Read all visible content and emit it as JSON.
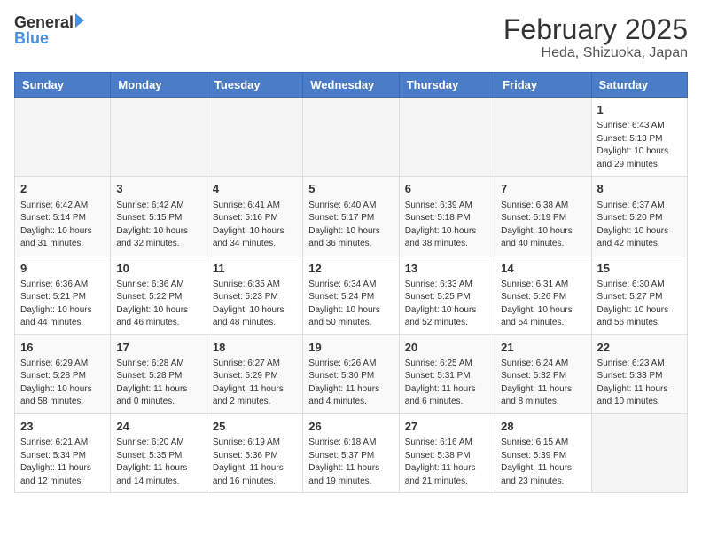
{
  "header": {
    "logo_general": "General",
    "logo_blue": "Blue",
    "month": "February 2025",
    "location": "Heda, Shizuoka, Japan"
  },
  "weekdays": [
    "Sunday",
    "Monday",
    "Tuesday",
    "Wednesday",
    "Thursday",
    "Friday",
    "Saturday"
  ],
  "weeks": [
    [
      {
        "day": "",
        "info": ""
      },
      {
        "day": "",
        "info": ""
      },
      {
        "day": "",
        "info": ""
      },
      {
        "day": "",
        "info": ""
      },
      {
        "day": "",
        "info": ""
      },
      {
        "day": "",
        "info": ""
      },
      {
        "day": "1",
        "info": "Sunrise: 6:43 AM\nSunset: 5:13 PM\nDaylight: 10 hours and 29 minutes."
      }
    ],
    [
      {
        "day": "2",
        "info": "Sunrise: 6:42 AM\nSunset: 5:14 PM\nDaylight: 10 hours and 31 minutes."
      },
      {
        "day": "3",
        "info": "Sunrise: 6:42 AM\nSunset: 5:15 PM\nDaylight: 10 hours and 32 minutes."
      },
      {
        "day": "4",
        "info": "Sunrise: 6:41 AM\nSunset: 5:16 PM\nDaylight: 10 hours and 34 minutes."
      },
      {
        "day": "5",
        "info": "Sunrise: 6:40 AM\nSunset: 5:17 PM\nDaylight: 10 hours and 36 minutes."
      },
      {
        "day": "6",
        "info": "Sunrise: 6:39 AM\nSunset: 5:18 PM\nDaylight: 10 hours and 38 minutes."
      },
      {
        "day": "7",
        "info": "Sunrise: 6:38 AM\nSunset: 5:19 PM\nDaylight: 10 hours and 40 minutes."
      },
      {
        "day": "8",
        "info": "Sunrise: 6:37 AM\nSunset: 5:20 PM\nDaylight: 10 hours and 42 minutes."
      }
    ],
    [
      {
        "day": "9",
        "info": "Sunrise: 6:36 AM\nSunset: 5:21 PM\nDaylight: 10 hours and 44 minutes."
      },
      {
        "day": "10",
        "info": "Sunrise: 6:36 AM\nSunset: 5:22 PM\nDaylight: 10 hours and 46 minutes."
      },
      {
        "day": "11",
        "info": "Sunrise: 6:35 AM\nSunset: 5:23 PM\nDaylight: 10 hours and 48 minutes."
      },
      {
        "day": "12",
        "info": "Sunrise: 6:34 AM\nSunset: 5:24 PM\nDaylight: 10 hours and 50 minutes."
      },
      {
        "day": "13",
        "info": "Sunrise: 6:33 AM\nSunset: 5:25 PM\nDaylight: 10 hours and 52 minutes."
      },
      {
        "day": "14",
        "info": "Sunrise: 6:31 AM\nSunset: 5:26 PM\nDaylight: 10 hours and 54 minutes."
      },
      {
        "day": "15",
        "info": "Sunrise: 6:30 AM\nSunset: 5:27 PM\nDaylight: 10 hours and 56 minutes."
      }
    ],
    [
      {
        "day": "16",
        "info": "Sunrise: 6:29 AM\nSunset: 5:28 PM\nDaylight: 10 hours and 58 minutes."
      },
      {
        "day": "17",
        "info": "Sunrise: 6:28 AM\nSunset: 5:28 PM\nDaylight: 11 hours and 0 minutes."
      },
      {
        "day": "18",
        "info": "Sunrise: 6:27 AM\nSunset: 5:29 PM\nDaylight: 11 hours and 2 minutes."
      },
      {
        "day": "19",
        "info": "Sunrise: 6:26 AM\nSunset: 5:30 PM\nDaylight: 11 hours and 4 minutes."
      },
      {
        "day": "20",
        "info": "Sunrise: 6:25 AM\nSunset: 5:31 PM\nDaylight: 11 hours and 6 minutes."
      },
      {
        "day": "21",
        "info": "Sunrise: 6:24 AM\nSunset: 5:32 PM\nDaylight: 11 hours and 8 minutes."
      },
      {
        "day": "22",
        "info": "Sunrise: 6:23 AM\nSunset: 5:33 PM\nDaylight: 11 hours and 10 minutes."
      }
    ],
    [
      {
        "day": "23",
        "info": "Sunrise: 6:21 AM\nSunset: 5:34 PM\nDaylight: 11 hours and 12 minutes."
      },
      {
        "day": "24",
        "info": "Sunrise: 6:20 AM\nSunset: 5:35 PM\nDaylight: 11 hours and 14 minutes."
      },
      {
        "day": "25",
        "info": "Sunrise: 6:19 AM\nSunset: 5:36 PM\nDaylight: 11 hours and 16 minutes."
      },
      {
        "day": "26",
        "info": "Sunrise: 6:18 AM\nSunset: 5:37 PM\nDaylight: 11 hours and 19 minutes."
      },
      {
        "day": "27",
        "info": "Sunrise: 6:16 AM\nSunset: 5:38 PM\nDaylight: 11 hours and 21 minutes."
      },
      {
        "day": "28",
        "info": "Sunrise: 6:15 AM\nSunset: 5:39 PM\nDaylight: 11 hours and 23 minutes."
      },
      {
        "day": "",
        "info": ""
      }
    ]
  ]
}
